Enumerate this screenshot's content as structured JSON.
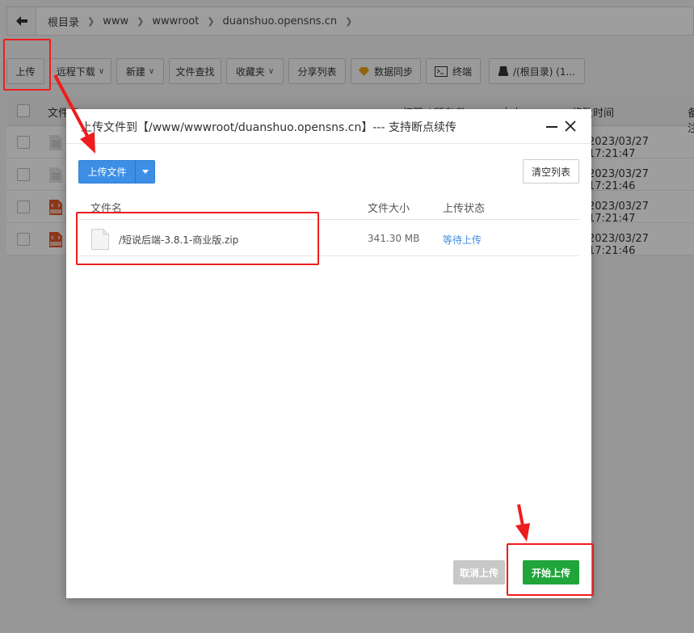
{
  "breadcrumb": {
    "segments": [
      "根目录",
      "www",
      "wwwroot",
      "duanshuo.opensns.cn"
    ]
  },
  "toolbar": {
    "upload": "上传",
    "remote_download": "远程下载",
    "new": "新建",
    "file_search": "文件查找",
    "favorites": "收藏夹",
    "share_list": "分享列表",
    "data_sync": "数据同步",
    "terminal": "终端",
    "disk": "/(根目录) (1..."
  },
  "table": {
    "columns": [
      "文件名",
      "权限 / 所有者",
      "大小",
      "修改时间",
      "备注"
    ],
    "rows": [
      {
        "icon": "text-file-icon",
        "modified": "2023/03/27 17:21:47"
      },
      {
        "icon": "text-file-icon",
        "modified": "2023/03/27 17:21:46"
      },
      {
        "icon": "html-file-icon",
        "modified": "2023/03/27 17:21:47"
      },
      {
        "icon": "html-file-icon",
        "modified": "2023/03/27 17:21:46"
      }
    ]
  },
  "dialog": {
    "title": "上传文件到【/www/wwwroot/duanshuo.opensns.cn】--- 支持断点续传",
    "upload_button": "上传文件",
    "clear_button": "清空列表",
    "columns": {
      "name": "文件名",
      "size": "文件大小",
      "status": "上传状态"
    },
    "files": [
      {
        "name": "/短说后端-3.8.1-商业版.zip",
        "size": "341.30 MB",
        "status": "等待上传"
      }
    ],
    "cancel_button": "取消上传",
    "start_button": "开始上传"
  },
  "colors": {
    "accent_blue": "#3d8fe6",
    "success_green": "#20a53a",
    "annotation_red": "#ee1d1d"
  }
}
